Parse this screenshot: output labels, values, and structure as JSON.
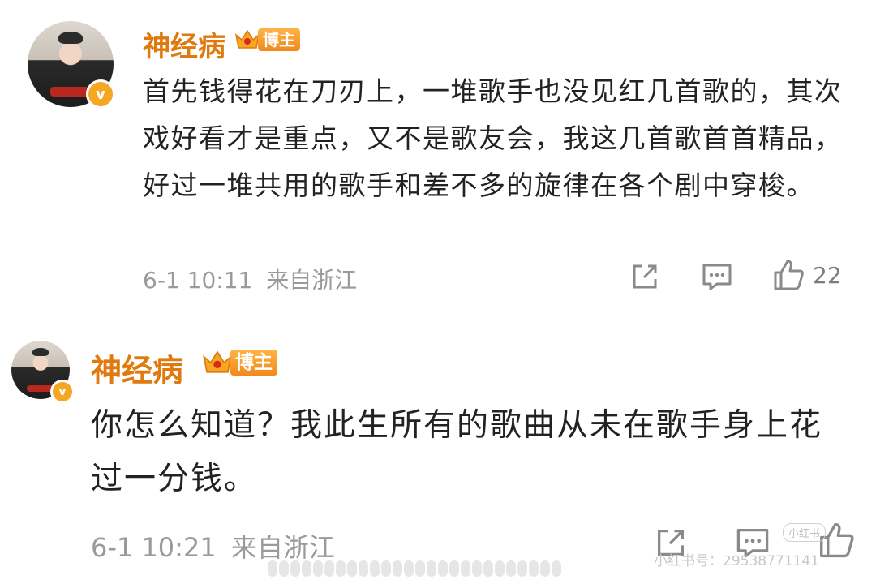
{
  "comments": [
    {
      "username": "神经病",
      "badge_label": "博主",
      "verified_mark": "v",
      "text": "首先钱得花在刀刃上，一堆歌手也没见红几首歌的，其次戏好看才是重点，又不是歌友会，我这几首歌首首精品，好过一堆共用的歌手和差不多的旋律在各个剧中穿梭。",
      "time": "6-1 10:11",
      "location": "来自浙江",
      "like_count": "22"
    },
    {
      "username": "神经病",
      "badge_label": "博主",
      "verified_mark": "v",
      "text": "你怎么知道？我此生所有的歌曲从未在歌手身上花过一分钱。",
      "time": "6-1 10:21",
      "location": "来自浙江",
      "like_count": ""
    }
  ],
  "watermark": {
    "logo_text": "小红书",
    "text": "小红书号：29538771141"
  },
  "colors": {
    "username": "#e07a0e",
    "badge": "#f08a1c",
    "verified": "#f5a623",
    "meta": "#9a9a9a",
    "body": "#222222"
  },
  "icons": [
    "share-icon",
    "comment-icon",
    "like-icon",
    "verified-badge-icon",
    "crown-icon"
  ]
}
